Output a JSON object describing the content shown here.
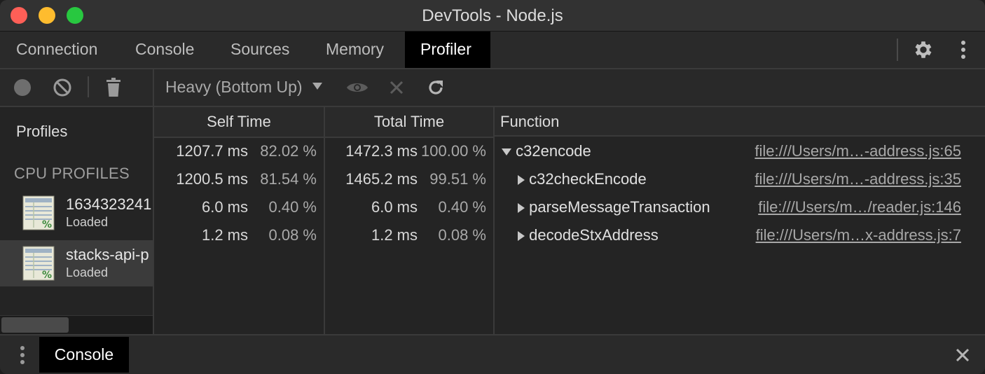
{
  "window": {
    "title": "DevTools - Node.js"
  },
  "tabs": [
    {
      "label": "Connection"
    },
    {
      "label": "Console"
    },
    {
      "label": "Sources"
    },
    {
      "label": "Memory"
    },
    {
      "label": "Profiler",
      "active": true
    }
  ],
  "toolbar": {
    "view_select": "Heavy (Bottom Up)",
    "icons": [
      "record-icon",
      "clear-icon",
      "trash-icon",
      "focus-eye-icon",
      "exclude-x-icon",
      "reload-icon"
    ]
  },
  "sidebar": {
    "profiles_heading": "Profiles",
    "cpu_heading": "CPU PROFILES",
    "profiles": [
      {
        "name": "1634323241",
        "status": "Loaded",
        "selected": false
      },
      {
        "name": "stacks-api-p",
        "status": "Loaded",
        "selected": true
      }
    ]
  },
  "grid": {
    "headers": {
      "self": "Self Time",
      "total": "Total Time",
      "function": "Function"
    },
    "rows": [
      {
        "self_ms": "1207.7 ms",
        "self_pct": "82.02 %",
        "total_ms": "1472.3 ms",
        "total_pct": "100.00 %",
        "expanded": true,
        "function": "c32encode",
        "url": "file:///Users/m…-address.js:65"
      },
      {
        "self_ms": "1200.5 ms",
        "self_pct": "81.54 %",
        "total_ms": "1465.2 ms",
        "total_pct": "99.51 %",
        "expanded": false,
        "function": "c32checkEncode",
        "url": "file:///Users/m…-address.js:35"
      },
      {
        "self_ms": "6.0 ms",
        "self_pct": "0.40 %",
        "total_ms": "6.0 ms",
        "total_pct": "0.40 %",
        "expanded": false,
        "function": "parseMessageTransaction",
        "url": "file:///Users/m…/reader.js:146"
      },
      {
        "self_ms": "1.2 ms",
        "self_pct": "0.08 %",
        "total_ms": "1.2 ms",
        "total_pct": "0.08 %",
        "expanded": false,
        "function": "decodeStxAddress",
        "url": "file:///Users/m…x-address.js:7"
      }
    ]
  },
  "drawer": {
    "tab_label": "Console"
  },
  "colors": {
    "traffic_close": "#fe5f57",
    "traffic_min": "#febc2e",
    "traffic_max": "#28c840",
    "active_tab_bg": "#000000"
  }
}
